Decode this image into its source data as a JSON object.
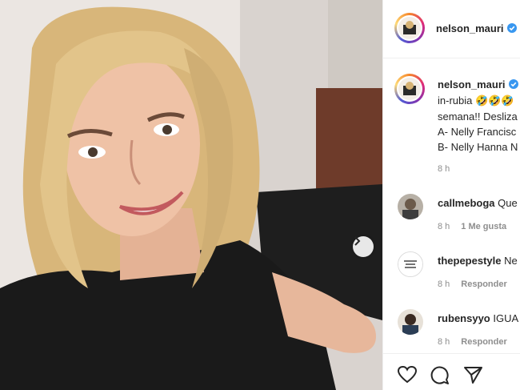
{
  "post": {
    "username": "nelson_mauri",
    "next_icon": "chevron-right-icon",
    "caption_lines": [
      "in-rubia 🤣🤣🤣",
      "semana!! Desliza",
      "A- Nelly Francisc",
      "B- Nelly Hanna N"
    ],
    "caption_time": "8 h"
  },
  "comments": [
    {
      "username": "callmeboga",
      "text": "Que",
      "time": "8 h",
      "action": "1 Me gusta"
    },
    {
      "username": "thepepestyle",
      "text": "Ne",
      "time": "8 h",
      "action": "Responder"
    },
    {
      "username": "rubensyyo",
      "text": "IGUA",
      "time": "8 h",
      "action": "Responder"
    }
  ],
  "icons": {
    "like": "heart-icon",
    "comment": "comment-icon",
    "share": "send-icon"
  },
  "colors": {
    "verified": "#3897f0",
    "muted": "#8e8e8e",
    "text": "#262626",
    "divider": "#efefef"
  }
}
